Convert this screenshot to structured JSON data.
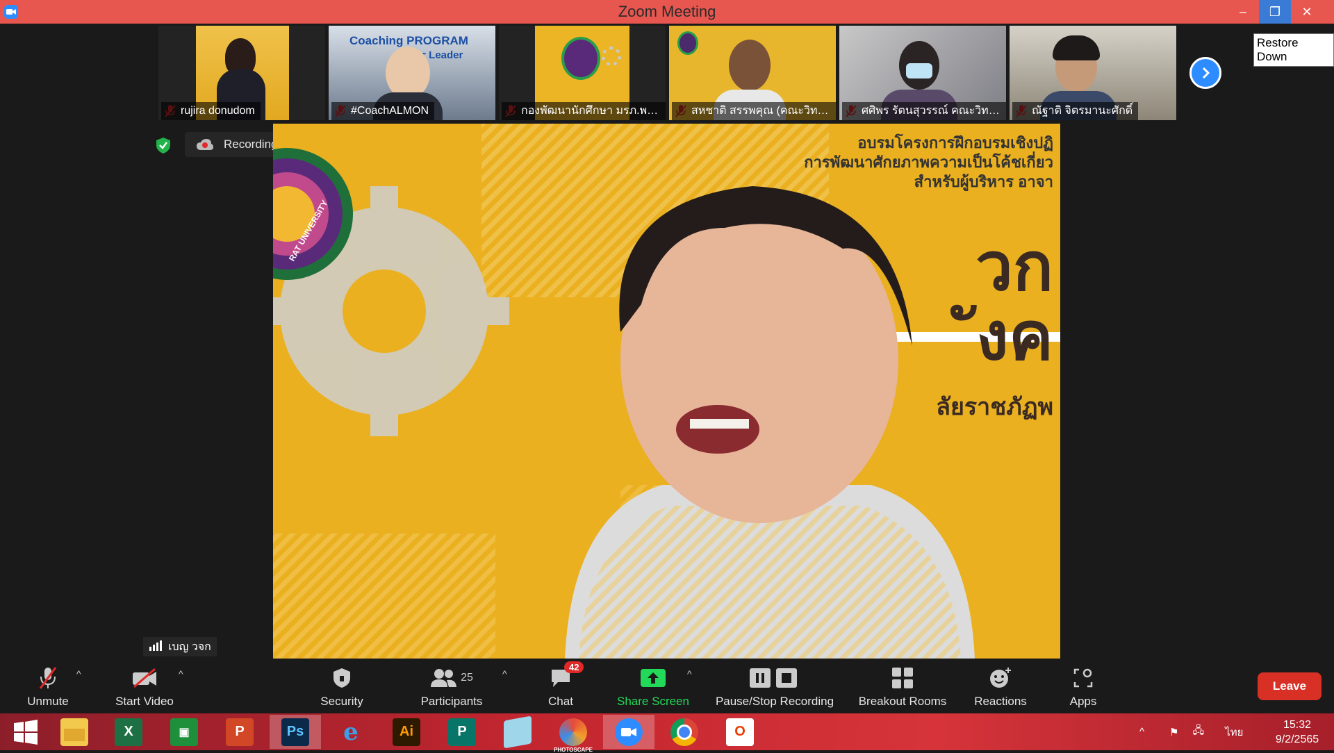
{
  "window": {
    "title": "Zoom Meeting",
    "restore_tooltip": "Restore Down",
    "minimize_glyph": "–",
    "restore_glyph": "❐",
    "close_glyph": "✕"
  },
  "gallery": {
    "participants": [
      {
        "name": "rujira donudom",
        "muted": true
      },
      {
        "name": "#CoachALMON",
        "muted": true
      },
      {
        "name": "กองพัฒนานักศึกษา มรภ.พร...",
        "muted": true
      },
      {
        "name": "สหชาติ สรรพคุณ (คณะวิทย์...",
        "muted": true
      },
      {
        "name": "ศศิพร รัตนสุวรรณ์ คณะวิทย...",
        "muted": true
      },
      {
        "name": "ณัฐาติ จิตรมานะศักดิ์",
        "muted": true
      }
    ],
    "tile2_caption": "Coaching PROGRAM",
    "tile2_caption2": "for Leader",
    "next_icon": "chevron-right-icon"
  },
  "recording": {
    "label": "Recording...",
    "pause_icon": "pause-icon",
    "stop_icon": "stop-icon"
  },
  "main_video": {
    "banner_line1": "อบรมโครงการฝึกอบรมเชิงปฏิ",
    "banner_line2": "การพัฒนาศักยภาพความเป็นโค้ชเกี่ยว",
    "banner_line3": "สำหรับผู้บริหาร อาจา",
    "big_text1": "วก",
    "big_text2": "ังค",
    "bottom_text": "ลัยราชภัฏพ",
    "logo_text": "RAT UNIVERSITY"
  },
  "active_speaker": "เบญ วจก",
  "toolbar": {
    "unmute": "Unmute",
    "start_video": "Start Video",
    "security": "Security",
    "participants": "Participants",
    "participants_count": "25",
    "chat": "Chat",
    "chat_badge": "42",
    "share_screen": "Share Screen",
    "pause_stop_recording": "Pause/Stop Recording",
    "breakout_rooms": "Breakout Rooms",
    "reactions": "Reactions",
    "apps": "Apps",
    "leave": "Leave",
    "share_color": "#23d959",
    "leave_color": "#d93025"
  },
  "taskbar": {
    "apps": [
      "windows-start",
      "file-explorer",
      "excel",
      "store",
      "powerpoint",
      "photoshop",
      "internet-explorer",
      "illustrator",
      "publisher",
      "notepad",
      "photoscape",
      "zoom",
      "chrome",
      "office"
    ],
    "photoshop_label": "Ps",
    "illustrator_label": "Ai",
    "photoscape_label": "PHOTOSCAPE",
    "language": "ไทย",
    "time": "15:32",
    "date": "9/2/2565"
  }
}
